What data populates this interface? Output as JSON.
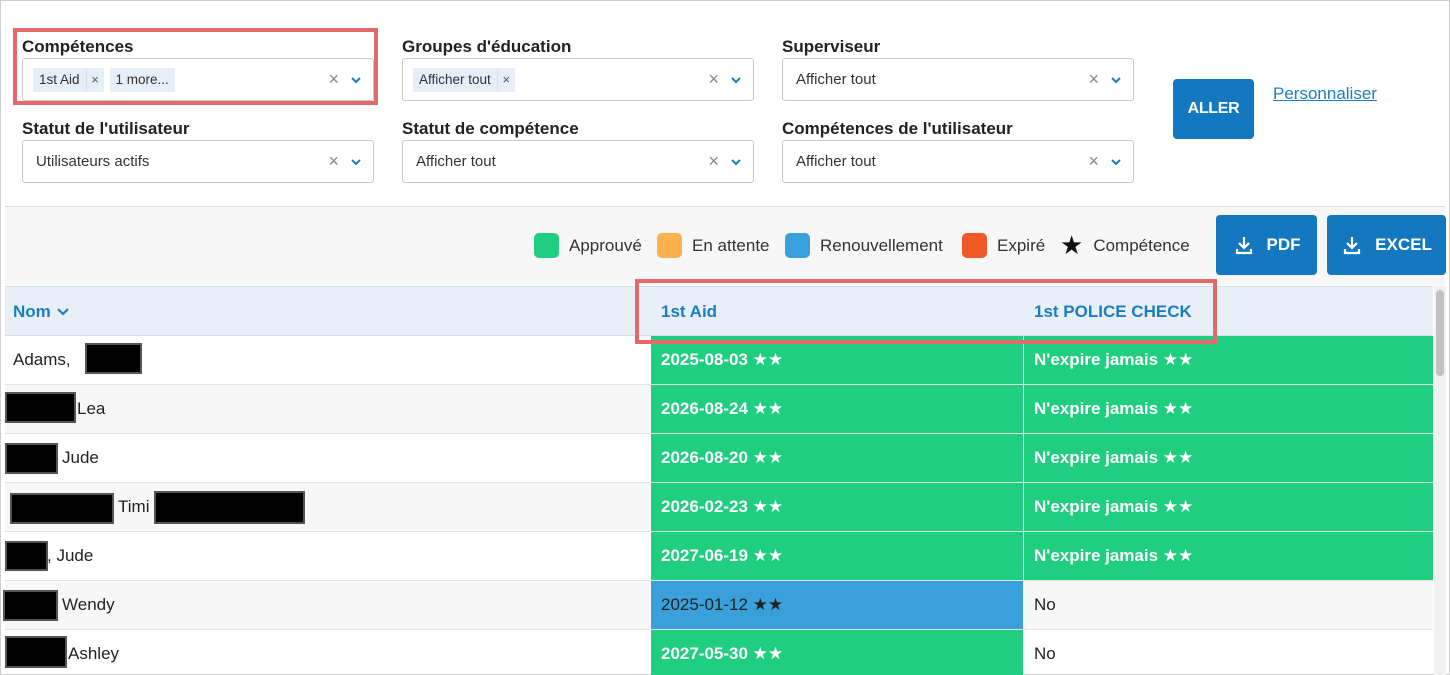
{
  "filters": {
    "competences": {
      "label": "Compétences",
      "chips": [
        "1st Aid",
        "1 more..."
      ],
      "chip_remove": "×"
    },
    "education_groups": {
      "label": "Groupes d'éducation",
      "chips": [
        "Afficher tout"
      ],
      "chip_remove": "×"
    },
    "supervisor": {
      "label": "Superviseur",
      "value": "Afficher tout"
    },
    "user_status": {
      "label": "Statut de l'utilisateur",
      "value": "Utilisateurs actifs"
    },
    "competence_status": {
      "label": "Statut de compétence",
      "value": "Afficher tout"
    },
    "user_competences": {
      "label": "Compétences de l'utilisateur",
      "value": "Afficher tout"
    },
    "clear_symbol": "×"
  },
  "actions": {
    "go_label": "ALLER",
    "customize_label": "Personnaliser",
    "pdf_label": "PDF",
    "excel_label": "EXCEL"
  },
  "legend": [
    {
      "label": "Approuvé",
      "color": "#1fce7f"
    },
    {
      "label": "En attente",
      "color": "#f9b24e"
    },
    {
      "label": "Renouvellement",
      "color": "#3aa0dc"
    },
    {
      "label": "Expiré",
      "color": "#f15a24"
    },
    {
      "label": "Compétence",
      "symbol": "★"
    }
  ],
  "table": {
    "columns": {
      "name": "Nom",
      "col1": "1st Aid",
      "col2": "1st POLICE CHECK"
    },
    "rows": [
      {
        "name": "Adams,",
        "c1": "2025-08-03 ★★",
        "c1_status": "approved",
        "c2": "N'expire jamais ★★",
        "c2_status": "approved"
      },
      {
        "name": "Lea",
        "c1": "2026-08-24 ★★",
        "c1_status": "approved",
        "c2": "N'expire jamais ★★",
        "c2_status": "approved"
      },
      {
        "name": "Jude",
        "c1": "2026-08-20 ★★",
        "c1_status": "approved",
        "c2": "N'expire jamais ★★",
        "c2_status": "approved"
      },
      {
        "name": "Timi",
        "c1": "2026-02-23 ★★",
        "c1_status": "approved",
        "c2": "N'expire jamais ★★",
        "c2_status": "approved"
      },
      {
        "name": ", Jude",
        "c1": "2027-06-19 ★★",
        "c1_status": "approved",
        "c2": "N'expire jamais ★★",
        "c2_status": "approved"
      },
      {
        "name": "Wendy",
        "c1": "2025-01-12 ★★",
        "c1_status": "renewal",
        "c2": "No",
        "c2_status": "plain"
      },
      {
        "name": "Ashley",
        "c1": "2027-05-30 ★★",
        "c1_status": "approved",
        "c2": "No",
        "c2_status": "plain"
      }
    ]
  },
  "colors": {
    "accent": "#1378bf",
    "link": "#1a7fc1",
    "highlight": "#e26a6a",
    "approved": "#1fce7f",
    "renewal": "#3aa0dc"
  }
}
